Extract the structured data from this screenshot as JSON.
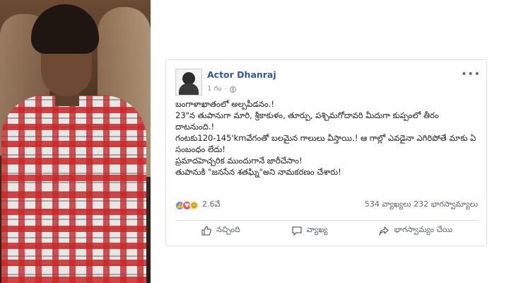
{
  "post": {
    "author": "Actor Dhanraj",
    "time": "1 గం",
    "lines": [
      "బంగాళాఖాతంలో అల్పపీడనం.!",
      "23\"న తుపానుగా మారి, శ్రీకాకుళం, తూర్పు, పశ్చిమగోదావరి మీదుగా కుప్పంలో తీరం దాటనుంది.!",
      "గంటకు120-145'kmవేగంతో బలమైన గాలులు వీస్తాయి.! ఆ గాల్లో ఎవడైనా ఎగిరిపోతే మాకు ఏ సంబంధం లేదు!",
      "ప్రమాదహెచ్చరిక ముందుగానే జారీచేసాం!",
      "తుపానుకి \"జనసేన శతఘ్ని\"అని నామకరణం చేశారు!"
    ],
    "reaction_count": "2.6వే",
    "comments": "534 వ్యాఖ్యలు",
    "shares": "232 భాగస్వామ్యాలు",
    "actions": {
      "like": "నచ్చింది",
      "comment": "వ్యాఖ్య",
      "share": "భాగస్వామ్యం చేయి"
    }
  },
  "icons": {
    "reactions": [
      "like-icon",
      "love-icon",
      "haha-icon"
    ],
    "more": "more-options-icon",
    "privacy": "globe-icon"
  }
}
